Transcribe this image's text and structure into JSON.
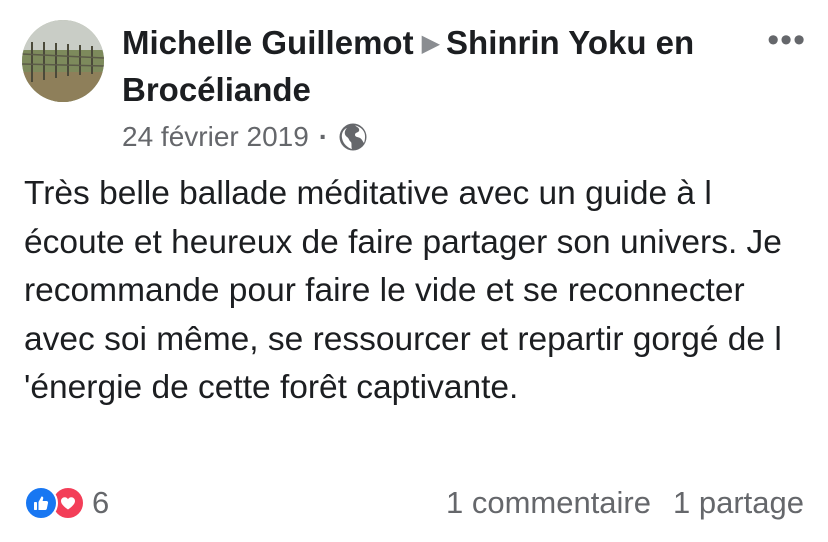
{
  "post": {
    "author": "Michelle Guillemot",
    "page_name": "Shinrin Yoku en Brocéliande",
    "date": "24 février 2019",
    "privacy_icon": "globe-icon",
    "more_icon": "more-options-icon",
    "text": "Très belle ballade méditative avec un guide à l écoute et heureux de faire partager son univers. Je recommande pour faire le vide et se reconnecter avec soi même, se ressourcer et repartir gorgé de l 'énergie de cette forêt captivante."
  },
  "footer": {
    "reaction_icons": [
      "like-icon",
      "love-icon"
    ],
    "reaction_count": "6",
    "comments": "1 commentaire",
    "shares": "1 partage"
  },
  "colors": {
    "text": "#1c1e21",
    "secondary": "#65676b",
    "like_blue": "#1877f2",
    "love_red": "#f33e58"
  }
}
